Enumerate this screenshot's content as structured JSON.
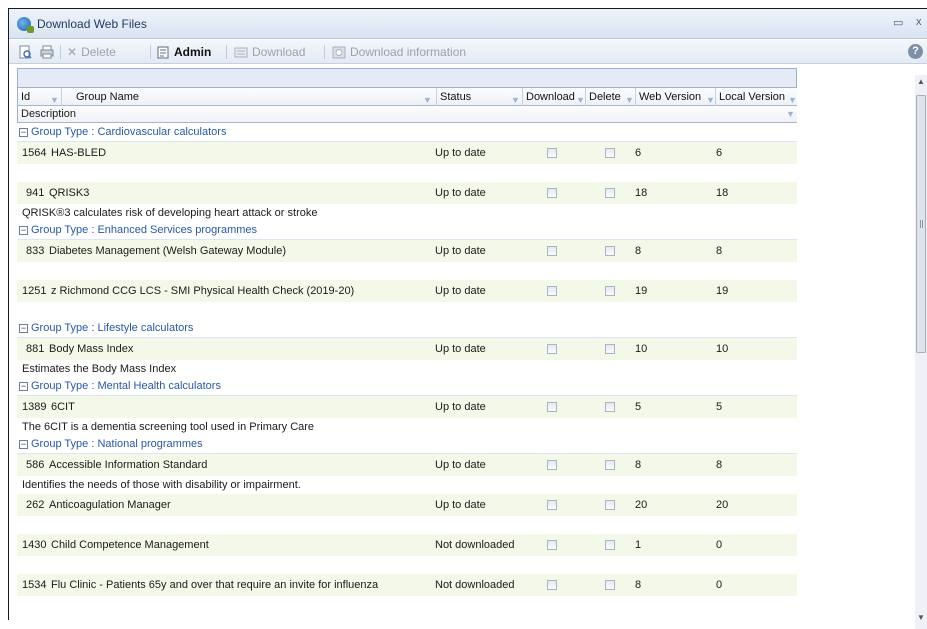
{
  "window": {
    "title": "Download Web Files",
    "minimize": "▭",
    "close": "x"
  },
  "toolbar": {
    "delete_label": "Delete",
    "admin_label": "Admin",
    "download_label": "Download",
    "download_info_label": "Download information",
    "help_label": "?"
  },
  "columns": {
    "id": "Id",
    "group_name": "Group Name",
    "status": "Status",
    "download": "Download",
    "delete": "Delete",
    "web_version": "Web Version",
    "local_version": "Local Version",
    "description": "Description"
  },
  "groups": [
    {
      "title": "Group Type : Cardiovascular calculators",
      "items": [
        {
          "id": "1564",
          "name": "HAS-BLED",
          "status": "Up to date",
          "web": "6",
          "local": "6",
          "description": ""
        },
        {
          "id": "941",
          "name": "QRISK3",
          "status": "Up to date",
          "web": "18",
          "local": "18",
          "description": "QRISK®3 calculates risk of developing heart attack or stroke"
        }
      ]
    },
    {
      "title": "Group Type : Enhanced Services programmes",
      "items": [
        {
          "id": "833",
          "name": "Diabetes Management (Welsh Gateway Module)",
          "status": "Up to date",
          "web": "8",
          "local": "8",
          "description": ""
        },
        {
          "id": "1251",
          "name": "z Richmond CCG LCS - SMI Physical Health Check (2019-20)",
          "status": "Up to date",
          "web": "19",
          "local": "19",
          "description": ""
        }
      ]
    },
    {
      "title": "Group Type : Lifestyle calculators",
      "items": [
        {
          "id": "881",
          "name": "Body Mass Index",
          "status": "Up to date",
          "web": "10",
          "local": "10",
          "description": "Estimates the Body Mass Index"
        }
      ]
    },
    {
      "title": "Group Type : Mental Health calculators",
      "items": [
        {
          "id": "1389",
          "name": "6CIT",
          "status": "Up to date",
          "web": "5",
          "local": "5",
          "description": "The 6CIT is a dementia screening tool used in Primary Care"
        }
      ]
    },
    {
      "title": "Group Type : National programmes",
      "items": [
        {
          "id": "586",
          "name": "Accessible Information Standard",
          "status": "Up to date",
          "web": "8",
          "local": "8",
          "description": "Identifies the needs of those with disability or impairment."
        },
        {
          "id": "262",
          "name": "Anticoagulation Manager",
          "status": "Up to date",
          "web": "20",
          "local": "20",
          "description": ""
        },
        {
          "id": "1430",
          "name": "Child Competence Management",
          "status": "Not downloaded",
          "web": "1",
          "local": "0",
          "description": ""
        },
        {
          "id": "1534",
          "name": "Flu Clinic - Patients 65y and over that require an invite for influenza",
          "status": "Not downloaded",
          "web": "8",
          "local": "0",
          "description": ""
        }
      ]
    }
  ]
}
